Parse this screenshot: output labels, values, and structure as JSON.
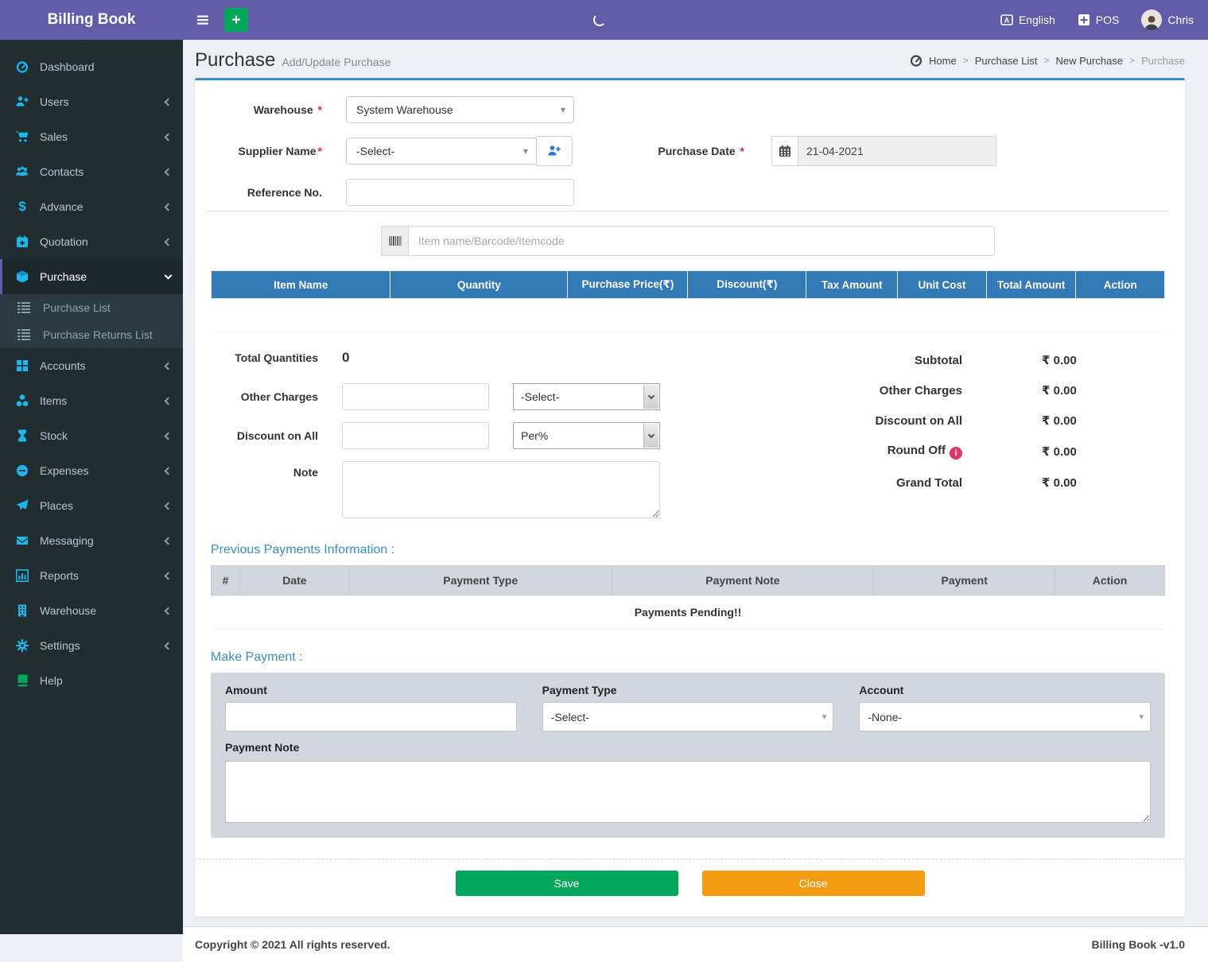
{
  "header": {
    "brand": "Billing Book",
    "language_label": "English",
    "pos_label": "POS",
    "user_name": "Chris"
  },
  "sidebar": {
    "items": [
      {
        "label": "Dashboard",
        "icon": "dashboard-icon",
        "chevron": false
      },
      {
        "label": "Users",
        "icon": "user-plus-icon",
        "chevron": true
      },
      {
        "label": "Sales",
        "icon": "cart-icon",
        "chevron": true
      },
      {
        "label": "Contacts",
        "icon": "people-icon",
        "chevron": true
      },
      {
        "label": "Advance",
        "icon": "dollar-icon",
        "chevron": true
      },
      {
        "label": "Quotation",
        "icon": "calendar-plus-icon",
        "chevron": true
      },
      {
        "label": "Purchase",
        "icon": "cube-icon",
        "chevron": "down",
        "active": true
      },
      {
        "label": "Accounts",
        "icon": "grid-icon",
        "chevron": true
      },
      {
        "label": "Items",
        "icon": "cubes-icon",
        "chevron": true
      },
      {
        "label": "Stock",
        "icon": "hourglass-icon",
        "chevron": true
      },
      {
        "label": "Expenses",
        "icon": "minus-circle-icon",
        "chevron": true
      },
      {
        "label": "Places",
        "icon": "paper-plane-icon",
        "chevron": true
      },
      {
        "label": "Messaging",
        "icon": "envelope-icon",
        "chevron": true
      },
      {
        "label": "Reports",
        "icon": "bar-chart-icon",
        "chevron": true
      },
      {
        "label": "Warehouse",
        "icon": "building-icon",
        "chevron": true
      },
      {
        "label": "Settings",
        "icon": "gears-icon",
        "chevron": true
      },
      {
        "label": "Help",
        "icon": "book-icon",
        "chevron": false
      }
    ],
    "purchase_submenu": [
      {
        "label": "Purchase List",
        "icon": "list-icon"
      },
      {
        "label": "Purchase Returns List",
        "icon": "list-icon"
      }
    ]
  },
  "page": {
    "title": "Purchase",
    "subtitle": "Add/Update Purchase"
  },
  "breadcrumb": {
    "items": [
      "Home",
      "Purchase List",
      "New Purchase",
      "Purchase"
    ]
  },
  "form": {
    "required_mark": "*",
    "warehouse_label": "Warehouse",
    "warehouse_value": "System Warehouse",
    "supplier_label": "Supplier Name",
    "supplier_value": "-Select-",
    "reference_label": "Reference No.",
    "purchase_date_label": "Purchase Date",
    "purchase_date_value": "21-04-2021",
    "item_search_placeholder": "Item name/Barcode/Itemcode"
  },
  "items_table": {
    "headers": [
      "Item Name",
      "Quantity",
      "Purchase Price(₹)",
      "Discount(₹)",
      "Tax Amount",
      "Unit Cost",
      "Total Amount",
      "Action"
    ]
  },
  "summary_left": {
    "total_quantities_label": "Total Quantities",
    "total_quantities_value": "0",
    "other_charges_label": "Other Charges",
    "other_charges_select_value": "-Select-",
    "discount_label": "Discount on All",
    "discount_select_value": "Per%",
    "note_label": "Note"
  },
  "summary_right": {
    "rows": [
      {
        "label": "Subtotal",
        "amount": "₹ 0.00"
      },
      {
        "label": "Other Charges",
        "amount": "₹ 0.00"
      },
      {
        "label": "Discount on All",
        "amount": "₹ 0.00"
      },
      {
        "label": "Round Off",
        "amount": "₹ 0.00",
        "info_icon": "i"
      },
      {
        "label": "Grand Total",
        "amount": "₹ 0.00"
      }
    ]
  },
  "previous_payments": {
    "heading": "Previous Payments Information :",
    "headers": [
      "#",
      "Date",
      "Payment Type",
      "Payment Note",
      "Payment",
      "Action"
    ],
    "empty_message": "Payments Pending!!"
  },
  "make_payment": {
    "heading": "Make Payment :",
    "amount_label": "Amount",
    "payment_type_label": "Payment Type",
    "payment_type_value": "-Select-",
    "account_label": "Account",
    "account_value": "-None-",
    "payment_note_label": "Payment Note"
  },
  "actions": {
    "save": "Save",
    "close": "Close"
  },
  "footer": {
    "copyright": "Copyright © 2021 All rights reserved.",
    "version": "Billing Book -v1.0"
  },
  "colors": {
    "header_purple": "#605ca8",
    "sidebar_dark": "#222d32",
    "icon_cyan": "#1db7ea",
    "table_header_blue": "#337ab7",
    "heading_blue": "#3c8dbc",
    "save_green": "#00a65a",
    "close_orange": "#f39c12",
    "required_red": "#dd2c5c",
    "info_icon_red": "#e0365f"
  }
}
